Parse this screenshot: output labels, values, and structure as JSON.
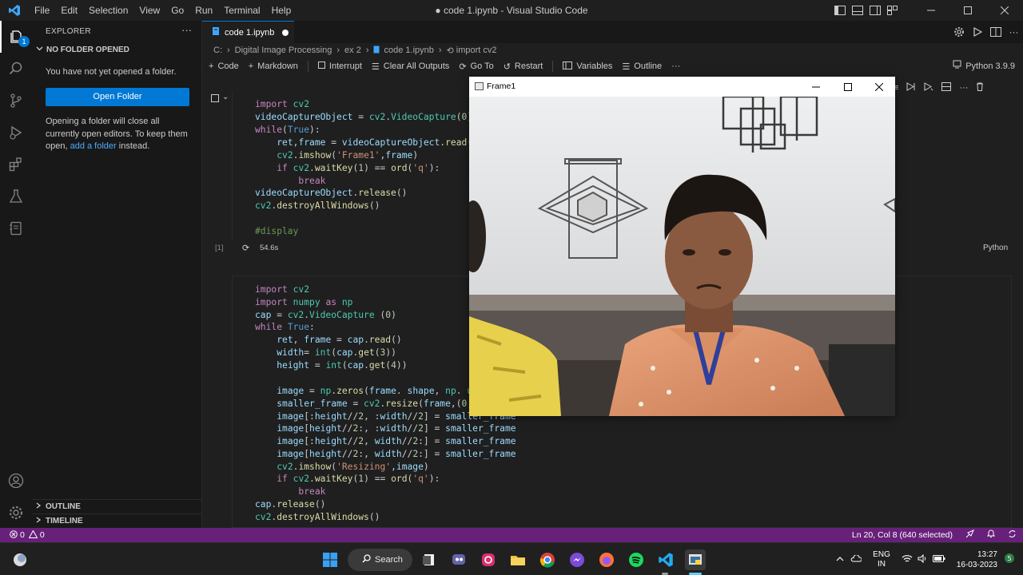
{
  "window": {
    "title": "● code 1.ipynb - Visual Studio Code",
    "menu": [
      "File",
      "Edit",
      "Selection",
      "View",
      "Go",
      "Run",
      "Terminal",
      "Help"
    ]
  },
  "activity_bar": {
    "items": [
      "explorer-icon",
      "search-icon",
      "source-control-icon",
      "run-debug-icon",
      "extensions-icon",
      "testing-icon",
      "jupyter-icon",
      "accounts-icon",
      "manage-gear-icon"
    ],
    "explorer_badge": "1"
  },
  "sidebar": {
    "title": "EXPLORER",
    "more": "···",
    "section": "NO FOLDER OPENED",
    "message1": "You have not yet opened a folder.",
    "open_folder_button": "Open Folder",
    "message2_a": "Opening a folder will close all currently open editors. To keep them open, ",
    "message2_link": "add a folder",
    "message2_b": " instead.",
    "outline": "OUTLINE",
    "timeline": "TIMELINE"
  },
  "tab": {
    "label": "code 1.ipynb"
  },
  "breadcrumb": [
    "C:",
    "Digital Image Processing",
    "ex 2",
    "code 1.ipynb",
    "import cv2"
  ],
  "notebook_toolbar": {
    "code": "Code",
    "markdown": "Markdown",
    "interrupt": "Interrupt",
    "clear_outputs": "Clear All Outputs",
    "goto": "Go To",
    "restart": "Restart",
    "variables": "Variables",
    "outline": "Outline",
    "more": "···",
    "kernel": "Python 3.9.9"
  },
  "cell1": {
    "exec_count": "[1]",
    "duration": "54.6s",
    "language": "Python"
  },
  "frame_window": {
    "title": "Frame1"
  },
  "statusbar": {
    "errors": "0",
    "warnings": "0",
    "position": "Ln 20, Col 8 (640 selected)"
  },
  "taskbar": {
    "search": "Search",
    "lang1": "ENG",
    "lang2": "IN",
    "time": "13:27",
    "date": "16-03-2023"
  },
  "colors": {
    "statusbar": "#68217a",
    "accent": "#0078d4",
    "editor_bg": "#1f1f1f"
  }
}
